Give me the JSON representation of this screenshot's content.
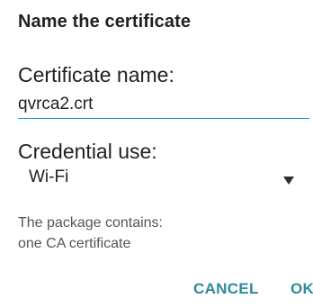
{
  "dialog": {
    "title": "Name the certificate",
    "certificate_name": {
      "label": "Certificate name:",
      "value": "qvrca2.crt"
    },
    "credential_use": {
      "label": "Credential use:",
      "selected": "Wi-Fi",
      "icon": "dropdown-caret-icon"
    },
    "package_info": {
      "line1": "The package contains:",
      "line2": "one CA certificate"
    },
    "buttons": {
      "cancel": "CANCEL",
      "ok": "OK"
    }
  },
  "colors": {
    "accent": "#2e8b99",
    "underline": "#1e88e5",
    "text_primary": "#212121",
    "text_secondary": "#555555"
  }
}
